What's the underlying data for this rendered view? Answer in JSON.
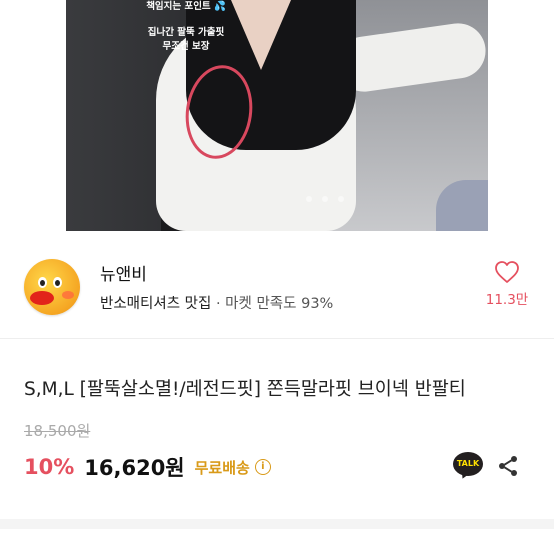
{
  "photo": {
    "callout_line1": "책임지는 포인트 💦",
    "callout_line2": "집나간 팔뚝 가출핏",
    "callout_line3": "무조건 보장"
  },
  "seller": {
    "name": "뉴앤비",
    "tagline": "반소매티셔츠 맛집",
    "separator": "·",
    "satisfaction": "마켓 만족도 93%",
    "like_count": "11.3만"
  },
  "product": {
    "title": "S,M,L [팔뚝살소멸!/레전드핏] 쫀득말라핏 브이넥 반팔티",
    "original_price": "18,500원",
    "discount": "10%",
    "price": "16,620원",
    "shipping": "무료배송",
    "info_icon_symbol": "i",
    "talk_label": "TALK"
  },
  "colors": {
    "accent_red": "#e5505f",
    "shipping_gold": "#d99a19",
    "talk_yellow": "#ffe100"
  },
  "icons": [
    "heart-icon",
    "info-icon",
    "kakao-talk-icon",
    "share-icon"
  ]
}
